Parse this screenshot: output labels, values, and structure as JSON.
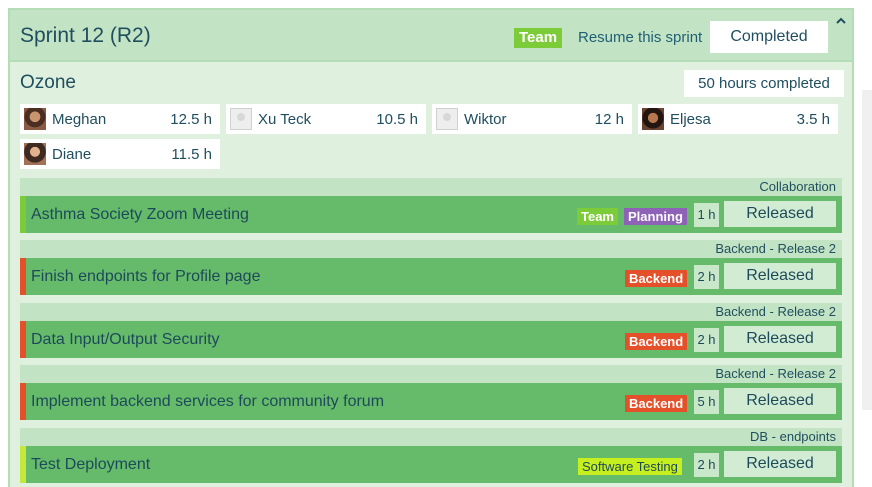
{
  "sprint": {
    "title": "Sprint 12 (R2)",
    "team_chip": "Team",
    "resume_label": "Resume this sprint",
    "status_button": "Completed"
  },
  "project": {
    "name": "Ozone",
    "hours_completed": "50 hours completed"
  },
  "members": [
    {
      "name": "Meghan",
      "hours": "12.5 h",
      "avatar": "photo"
    },
    {
      "name": "Xu Teck",
      "hours": "10.5 h",
      "avatar": "blank"
    },
    {
      "name": "Wiktor",
      "hours": "12 h",
      "avatar": "blank"
    },
    {
      "name": "Eljesa",
      "hours": "3.5 h",
      "avatar": "photo"
    },
    {
      "name": "Diane",
      "hours": "11.5 h",
      "avatar": "photo"
    }
  ],
  "tasks": [
    {
      "group": "Collaboration",
      "title": "Asthma Society Zoom Meeting",
      "tags": [
        "Team",
        "Planning"
      ],
      "estimate": "1 h",
      "status": "Released",
      "accent": "#7ccb39"
    },
    {
      "group": "Backend - Release 2",
      "title": "Finish endpoints for Profile page",
      "tags": [
        "Backend"
      ],
      "estimate": "2 h",
      "status": "Released",
      "accent": "#e3502a"
    },
    {
      "group": "Backend - Release 2",
      "title": "Data Input/Output Security",
      "tags": [
        "Backend"
      ],
      "estimate": "2 h",
      "status": "Released",
      "accent": "#e3502a"
    },
    {
      "group": "Backend - Release 2",
      "title": "Implement backend services for community forum",
      "tags": [
        "Backend"
      ],
      "estimate": "5 h",
      "status": "Released",
      "accent": "#e3502a"
    },
    {
      "group": "DB - endpoints",
      "title": "Test Deployment",
      "tags": [
        "Software Testing"
      ],
      "estimate": "2 h",
      "status": "Released",
      "accent": "#c6e83a"
    }
  ],
  "colors": {
    "team": "#7ccb39",
    "planning": "#8e63b7",
    "backend": "#e3502a",
    "software_testing": "#c6ef1f",
    "task_bg": "#66bb6a"
  },
  "icons": {
    "collapse": "chevron-up-icon"
  }
}
